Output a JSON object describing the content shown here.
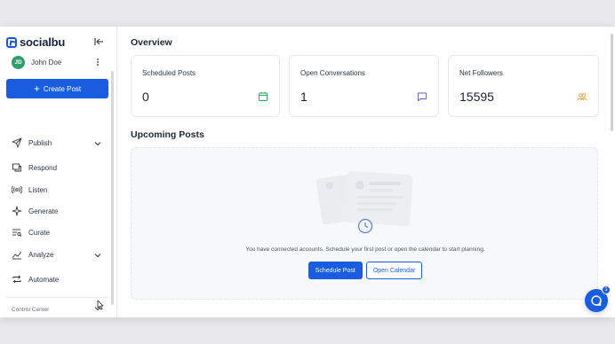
{
  "app": {
    "brand": "socialbu"
  },
  "user": {
    "initials": "JD",
    "name": "John Doe"
  },
  "sidebar": {
    "create_label": "Create Post",
    "items": [
      {
        "label": "Publish",
        "icon": "send-icon",
        "expandable": true
      },
      {
        "label": "Respond",
        "icon": "chat-icon",
        "expandable": false
      },
      {
        "label": "Listen",
        "icon": "broadcast-icon",
        "expandable": false
      },
      {
        "label": "Generate",
        "icon": "sparkle-icon",
        "expandable": false
      },
      {
        "label": "Curate",
        "icon": "filter-list-icon",
        "expandable": false
      },
      {
        "label": "Analyze",
        "icon": "chart-line-icon",
        "expandable": true
      },
      {
        "label": "Automate",
        "icon": "repeat-icon",
        "expandable": false
      }
    ],
    "control_center": "Control Center"
  },
  "overview": {
    "title": "Overview",
    "cards": [
      {
        "title": "Scheduled Posts",
        "value": "0",
        "icon": "calendar-icon",
        "color": "#22a35a"
      },
      {
        "title": "Open Conversations",
        "value": "1",
        "icon": "message-icon",
        "color": "#6a4fd9"
      },
      {
        "title": "Net Followers",
        "value": "15595",
        "icon": "users-icon",
        "color": "#d89a2b"
      }
    ]
  },
  "upcoming": {
    "title": "Upcoming Posts",
    "empty_text": "You have connected accounts. Schedule your first post or open the calendar to start planning.",
    "schedule_label": "Schedule Post",
    "calendar_label": "Open Calendar"
  },
  "chat": {
    "badge": "1"
  },
  "colors": {
    "accent": "#1a5ce0",
    "avatar": "#2e9f6a"
  }
}
